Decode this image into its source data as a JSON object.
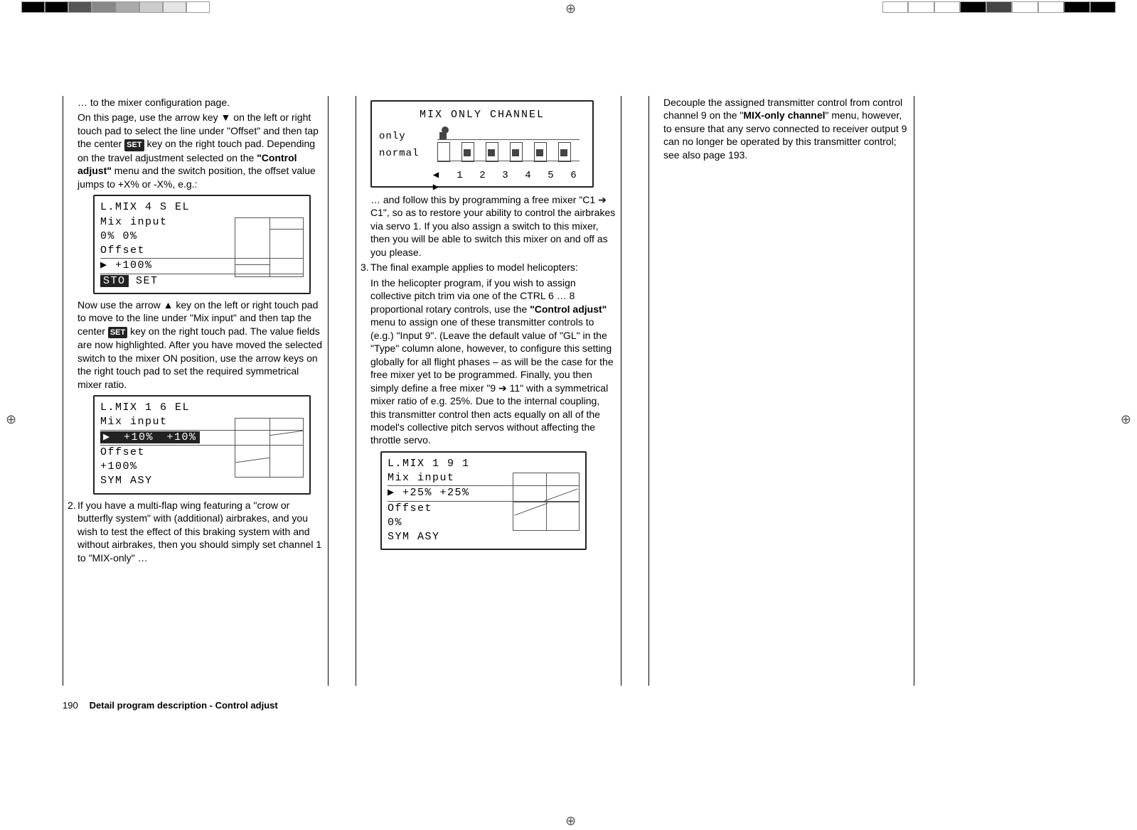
{
  "column1": {
    "p1": "… to the mixer configuration page.",
    "p2a": "On this page, use the arrow key ▼ on the left or right touch pad to select the line under \"Offset\" and then tap the center ",
    "p2_set": "SET",
    "p2b": " key on the right touch pad. Depending on the travel adjustment selected on the ",
    "p2_bold": "\"Control adjust\"",
    "p2c": " menu and the switch position, the offset value jumps to +X% or -X%, e.g.:",
    "lcd1": {
      "r1": "L.MIX  4       S EL",
      "r2": "Mix input",
      "r3": "     0%    0%",
      "r4": "Offset",
      "r5": "▶ +100%",
      "r6a": "STO",
      "r6b": "   SET"
    },
    "p3a": "Now use the arrow ▲ key on the left or right touch pad to move to the line under \"Mix input\" and then tap the center ",
    "p3_set": "SET",
    "p3b": " key on the right touch pad. The value fields are now highlighted. After you have moved the selected switch to the mixer ON position, use the arrow keys on the right touch pad to set the required symmetrical mixer ratio.",
    "lcd2": {
      "r1": "L.MIX  1       6 EL",
      "r2": "Mix input",
      "r3a": "▶",
      "r3b": " +10%",
      "r3c": " +10%",
      "r4": "Offset",
      "r5": " +100%",
      "r6": " SYM    ASY"
    },
    "p4": "If you have a multi-flap wing featuring a \"crow or butterfly system\" with (additional) airbrakes, and you wish to test the effect of this braking system with and without airbrakes, then you should simply set channel 1 to \"MIX-only\" …",
    "list2_num": "2."
  },
  "column2": {
    "lcdMx": {
      "title": "MIX  ONLY  CHANNEL",
      "lab1": "only",
      "lab2": "normal",
      "nums": [
        "1",
        "2",
        "3",
        "4",
        "5",
        "6"
      ],
      "arrL": "◀",
      "arrR": "▶"
    },
    "p1": "… and follow this by programming a free mixer \"C1 ➔ C1\", so as to restore your ability to control the airbrakes via servo 1. If you also assign a switch to this mixer, then you will be able to switch this mixer on and off as you please.",
    "list3_num": "3.",
    "p2": "The final example applies to model helicopters:",
    "p3a": "In the helicopter program, if you wish to assign collective pitch trim via one of the CTRL 6 … 8 proportional rotary controls, use the ",
    "p3_bold": "\"Control adjust\"",
    "p3b": " menu to assign one of these transmitter controls to (e.g.) \"Input 9\". (Leave the default value of \"GL\" in the \"Type\" column alone, however, to configure this setting globally for all flight phases – as will be the case for the free mixer yet to be programmed. Finally, you then simply define a free mixer \"9 ➔ 11\" with a symmetrical mixer ratio of e.g. 25%. Due to the internal coupling, this transmitter control then acts equally on all of the model's collective pitch servos without affecting the throttle servo.",
    "lcd3": {
      "r1": "L.MIX  1       9   1",
      "r2": "Mix input",
      "r3a": "▶",
      "r3b": " +25%",
      "r3c": " +25%",
      "r4": "Offset",
      "r5": "     0%",
      "r6": " SYM    ASY"
    }
  },
  "column3": {
    "p1a": "Decouple the assigned transmitter control from control channel 9 on the \"",
    "p1_bold": "MIX-only channel",
    "p1b": "\" menu, however, to ensure that any servo connected to receiver output 9 can no longer be operated by this transmitter control; see also page 193."
  },
  "footer": {
    "page": "190",
    "title": "Detail program description - Control adjust"
  },
  "chart_data": [
    {
      "type": "table",
      "title": "L.MIX 4  S→EL",
      "rows": [
        [
          "Mix input",
          "0%",
          "0%"
        ],
        [
          "Offset",
          "+100%",
          ""
        ]
      ],
      "actions": [
        "STO",
        "SET"
      ]
    },
    {
      "type": "table",
      "title": "L.MIX 1  6→EL",
      "rows": [
        [
          "Mix input",
          "+10%",
          "+10%"
        ],
        [
          "Offset",
          "+100%",
          ""
        ]
      ],
      "actions": [
        "SYM",
        "ASY"
      ]
    },
    {
      "type": "bar",
      "title": "MIX ONLY CHANNEL",
      "categories": [
        "1",
        "2",
        "3",
        "4",
        "5",
        "6"
      ],
      "series": [
        {
          "name": "only",
          "values": [
            1,
            0,
            0,
            0,
            0,
            0
          ]
        },
        {
          "name": "normal",
          "values": [
            0,
            1,
            1,
            1,
            1,
            1
          ]
        }
      ]
    },
    {
      "type": "table",
      "title": "L.MIX 1  9→1",
      "rows": [
        [
          "Mix input",
          "+25%",
          "+25%"
        ],
        [
          "Offset",
          "0%",
          ""
        ]
      ],
      "actions": [
        "SYM",
        "ASY"
      ]
    }
  ]
}
